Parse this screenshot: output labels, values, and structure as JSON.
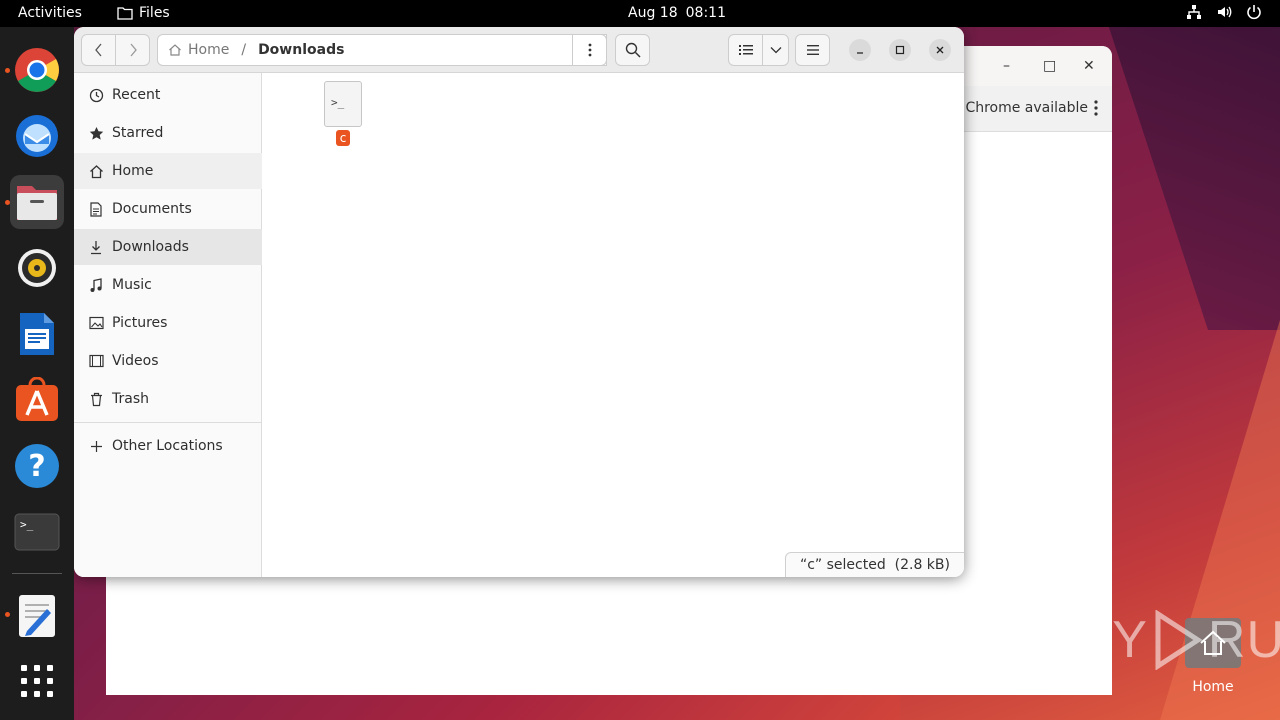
{
  "topbar": {
    "activities": "Activities",
    "app_name": "Files",
    "date": "Aug 18",
    "time": "08:11"
  },
  "dock": {
    "items": [
      {
        "name": "chrome"
      },
      {
        "name": "thunderbird"
      },
      {
        "name": "files"
      },
      {
        "name": "rhythmbox"
      },
      {
        "name": "libreoffice-writer"
      },
      {
        "name": "app-center"
      },
      {
        "name": "help"
      },
      {
        "name": "terminal"
      },
      {
        "name": "text-editor"
      },
      {
        "name": "show-apps"
      }
    ]
  },
  "bg_window": {
    "message": "Chrome available",
    "minimize": "–",
    "maximize": "□",
    "close": "✕"
  },
  "files": {
    "breadcrumb": {
      "home": "Home",
      "separator": "/",
      "current": "Downloads"
    },
    "sidebar": [
      {
        "label": "Recent",
        "icon": "clock-icon"
      },
      {
        "label": "Starred",
        "icon": "star-icon"
      },
      {
        "label": "Home",
        "icon": "home-icon"
      },
      {
        "label": "Documents",
        "icon": "document-icon"
      },
      {
        "label": "Downloads",
        "icon": "download-icon"
      },
      {
        "label": "Music",
        "icon": "music-icon"
      },
      {
        "label": "Pictures",
        "icon": "picture-icon"
      },
      {
        "label": "Videos",
        "icon": "video-icon"
      },
      {
        "label": "Trash",
        "icon": "trash-icon"
      }
    ],
    "other_locations": "Other Locations",
    "file": {
      "name": "c",
      "icon_text": ">_"
    },
    "status": "“c” selected  (2.8 kB)"
  },
  "desktop": {
    "home_label": "Home"
  },
  "watermark": {
    "text_left": "ANY",
    "text_right": "RUN"
  },
  "colors": {
    "accent": "#e95420",
    "topbar": "#000000",
    "dock": "#1d1d1d"
  }
}
